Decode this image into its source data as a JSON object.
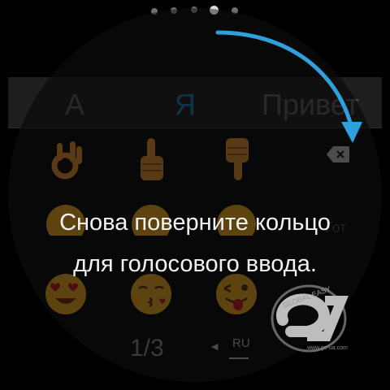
{
  "pager": {
    "count": 5,
    "active_index": 3
  },
  "suggestions": [
    {
      "label": "А",
      "active": false
    },
    {
      "label": "Я",
      "active": true
    },
    {
      "label": "Привет",
      "active": false
    }
  ],
  "emoji_rows": [
    [
      "ok-hand-icon",
      "thumbs-up-icon",
      "thumbs-down-icon"
    ],
    [
      "smiling-face-icon",
      "smiling-face-icon",
      "smiling-face-icon"
    ],
    [
      "heart-eyes-icon",
      "kissing-face-icon",
      "winking-tongue-icon"
    ]
  ],
  "keys": {
    "backspace_icon": "backspace-icon",
    "done_label": "Гот"
  },
  "hint": {
    "line1": "Снова поверните кольцо",
    "line2": "для голосового ввода."
  },
  "page_indicator": "1/3",
  "language": {
    "code": "RU",
    "switch_icon": "left-triangle-icon"
  },
  "watermark": {
    "text": "GLOBAL EASY",
    "url": "www.ge-ua.com"
  },
  "colors": {
    "accent": "#1f8bd0",
    "arrow": "#2ea0dd",
    "emoji": "#c98f3a"
  }
}
